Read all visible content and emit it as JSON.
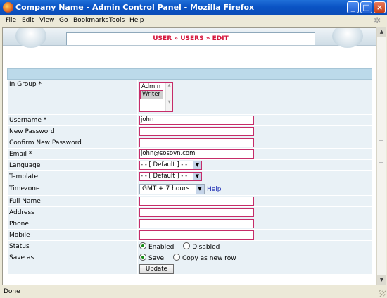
{
  "window": {
    "title": "Company Name - Admin Control Panel - Mozilla Firefox",
    "controls": {
      "minimize": "_",
      "maximize": "□",
      "close": "×"
    }
  },
  "menu": {
    "items": [
      "File",
      "Edit",
      "View",
      "Go",
      "Bookmarks",
      "Tools",
      "Help"
    ]
  },
  "breadcrumb": {
    "text": "USER » USERS » EDIT"
  },
  "form": {
    "in_group": {
      "label": "In Group *",
      "options": [
        "Admin",
        "Writer"
      ],
      "selected": "Writer"
    },
    "username": {
      "label": "Username *",
      "value": "john"
    },
    "new_password": {
      "label": "New Password",
      "value": ""
    },
    "confirm_password": {
      "label": "Confirm New Password",
      "value": ""
    },
    "email": {
      "label": "Email *",
      "value": "john@sosovn.com"
    },
    "language": {
      "label": "Language",
      "value": "- - [ Default ] - -"
    },
    "template": {
      "label": "Template",
      "value": "- - [ Default ] - -"
    },
    "timezone": {
      "label": "Timezone",
      "value": "GMT + 7 hours",
      "help": "Help"
    },
    "full_name": {
      "label": "Full Name",
      "value": ""
    },
    "address": {
      "label": "Address",
      "value": ""
    },
    "phone": {
      "label": "Phone",
      "value": ""
    },
    "mobile": {
      "label": "Mobile",
      "value": ""
    },
    "status": {
      "label": "Status",
      "options": [
        "Enabled",
        "Disabled"
      ],
      "selected": "Enabled"
    },
    "save_as": {
      "label": "Save as",
      "options": [
        "Save",
        "Copy as new row"
      ],
      "selected": "Save"
    },
    "submit": "Update"
  },
  "statusbar": {
    "text": "Done"
  },
  "colors": {
    "accent": "#d5163c",
    "field_border": "#c62c69",
    "header_bar": "#bcdaea",
    "row_bg": "#e9f1f6"
  }
}
